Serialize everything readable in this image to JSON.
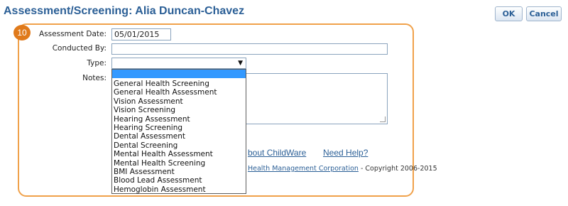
{
  "header": {
    "title": "Assessment/Screening: Alia Duncan-Chavez",
    "ok_label": "OK",
    "cancel_label": "Cancel"
  },
  "step_number": "10",
  "form": {
    "assessment_date_label": "Assessment Date:",
    "assessment_date_value": "05/01/2015",
    "conducted_by_label": "Conducted By:",
    "conducted_by_value": "",
    "type_label": "Type:",
    "type_value": "",
    "notes_label": "Notes:",
    "notes_value": ""
  },
  "type_options": [
    "General Health Screening",
    "General Health Assessment",
    "Vision Assessment",
    "Vision Screening",
    "Hearing Assessment",
    "Hearing Screening",
    "Dental Assessment",
    "Dental Screening",
    "Mental Health Assessment",
    "Mental Health Screening",
    "BMI Assessment",
    "Blood Lead Assessment",
    "Hemoglobin Assessment"
  ],
  "footer": {
    "about_link": "bout ChildWare",
    "help_link": "Need Help?",
    "company_link": "Health Management Corporation",
    "copyright_text": " - Copyright 2006-2015"
  },
  "colors": {
    "title_blue": "#2b5f96",
    "highlight_orange": "#f0a14a",
    "badge_orange": "#e07a1b",
    "selection_blue": "#3399ff"
  },
  "icons": {
    "dropdown": "chevron-down-icon"
  }
}
